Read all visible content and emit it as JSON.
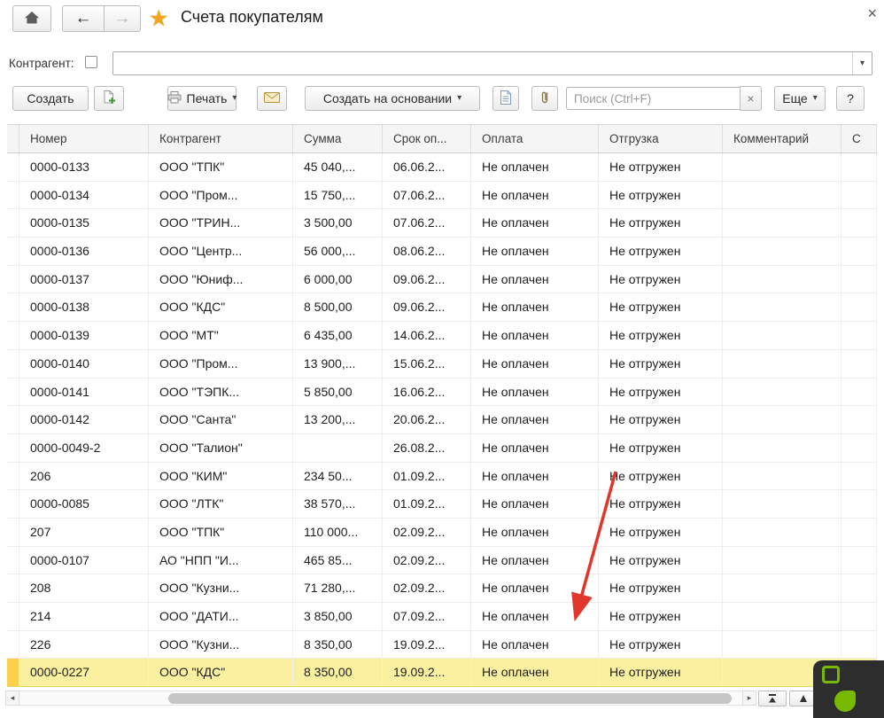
{
  "window": {
    "title": "Счета покупателям",
    "close_label": "×"
  },
  "nav": {
    "back_label": "←",
    "forward_label": "→",
    "favorite_star": "★"
  },
  "filter": {
    "label": "Контрагент:",
    "value": "",
    "caret": "▾"
  },
  "toolbar": {
    "create_label": "Создать",
    "print_label": "Печать",
    "create_based_on_label": "Создать на основании",
    "search_placeholder": "Поиск (Ctrl+F)",
    "clear_label": "×",
    "more_label": "Еще",
    "help_label": "?",
    "caret": "▾"
  },
  "table": {
    "columns": [
      "Номер",
      "Контрагент",
      "Сумма",
      "Срок оп...",
      "Оплата",
      "Отгрузка",
      "Комментарий",
      "С"
    ],
    "rows": [
      {
        "number": "0000-0133",
        "counterparty": "ООО \"ТПК\"",
        "sum": "45 040,...",
        "due": "06.06.2...",
        "payment": "Не оплачен",
        "shipment": "Не отгружен",
        "comment": "",
        "overdue": true,
        "highlighted": false
      },
      {
        "number": "0000-0134",
        "counterparty": "ООО \"Пром...",
        "sum": "15 750,...",
        "due": "07.06.2...",
        "payment": "Не оплачен",
        "shipment": "Не отгружен",
        "comment": "",
        "overdue": true,
        "highlighted": false
      },
      {
        "number": "0000-0135",
        "counterparty": "ООО \"ТРИН...",
        "sum": "3 500,00",
        "due": "07.06.2...",
        "payment": "Не оплачен",
        "shipment": "Не отгружен",
        "comment": "",
        "overdue": true,
        "highlighted": false
      },
      {
        "number": "0000-0136",
        "counterparty": "ООО \"Центр...",
        "sum": "56 000,...",
        "due": "08.06.2...",
        "payment": "Не оплачен",
        "shipment": "Не отгружен",
        "comment": "",
        "overdue": true,
        "highlighted": false
      },
      {
        "number": "0000-0137",
        "counterparty": "ООО \"Юниф...",
        "sum": "6 000,00",
        "due": "09.06.2...",
        "payment": "Не оплачен",
        "shipment": "Не отгружен",
        "comment": "",
        "overdue": true,
        "highlighted": false
      },
      {
        "number": "0000-0138",
        "counterparty": "ООО \"КДС\"",
        "sum": "8 500,00",
        "due": "09.06.2...",
        "payment": "Не оплачен",
        "shipment": "Не отгружен",
        "comment": "",
        "overdue": true,
        "highlighted": false
      },
      {
        "number": "0000-0139",
        "counterparty": "ООО \"МТ\"",
        "sum": "6 435,00",
        "due": "14.06.2...",
        "payment": "Не оплачен",
        "shipment": "Не отгружен",
        "comment": "",
        "overdue": true,
        "highlighted": false
      },
      {
        "number": "0000-0140",
        "counterparty": "ООО \"Пром...",
        "sum": "13 900,...",
        "due": "15.06.2...",
        "payment": "Не оплачен",
        "shipment": "Не отгружен",
        "comment": "",
        "overdue": true,
        "highlighted": false
      },
      {
        "number": "0000-0141",
        "counterparty": "ООО \"ТЭПК...",
        "sum": "5 850,00",
        "due": "16.06.2...",
        "payment": "Не оплачен",
        "shipment": "Не отгружен",
        "comment": "",
        "overdue": true,
        "highlighted": false
      },
      {
        "number": "0000-0142",
        "counterparty": "ООО \"Санта\"",
        "sum": "13 200,...",
        "due": "20.06.2...",
        "payment": "Не оплачен",
        "shipment": "Не отгружен",
        "comment": "",
        "overdue": true,
        "highlighted": false
      },
      {
        "number": "0000-0049-2",
        "counterparty": "ООО \"Талион\"",
        "sum": "",
        "due": "26.08.2...",
        "payment": "Не оплачен",
        "shipment": "Не отгружен",
        "comment": "",
        "overdue": true,
        "highlighted": false
      },
      {
        "number": "206",
        "counterparty": "ООО \"КИМ\"",
        "sum": "234 50...",
        "due": "01.09.2...",
        "payment": "Не оплачен",
        "shipment": "Не отгружен",
        "comment": "",
        "overdue": true,
        "highlighted": false
      },
      {
        "number": "0000-0085",
        "counterparty": "ООО \"ЛТК\"",
        "sum": "38 570,...",
        "due": "01.09.2...",
        "payment": "Не оплачен",
        "shipment": "Не отгружен",
        "comment": "",
        "overdue": true,
        "highlighted": false
      },
      {
        "number": "207",
        "counterparty": "ООО \"ТПК\"",
        "sum": "110 000...",
        "due": "02.09.2...",
        "payment": "Не оплачен",
        "shipment": "Не отгружен",
        "comment": "",
        "overdue": true,
        "highlighted": false
      },
      {
        "number": "0000-0107",
        "counterparty": "АО \"НПП \"И...",
        "sum": "465 85...",
        "due": "02.09.2...",
        "payment": "Не оплачен",
        "shipment": "Не отгружен",
        "comment": "",
        "overdue": true,
        "highlighted": false
      },
      {
        "number": "208",
        "counterparty": "ООО \"Кузни...",
        "sum": "71 280,...",
        "due": "02.09.2...",
        "payment": "Не оплачен",
        "shipment": "Не отгружен",
        "comment": "",
        "overdue": true,
        "highlighted": false
      },
      {
        "number": "214",
        "counterparty": "ООО \"ДАТИ...",
        "sum": "3 850,00",
        "due": "07.09.2...",
        "payment": "Не оплачен",
        "shipment": "Не отгружен",
        "comment": "",
        "overdue": true,
        "highlighted": false
      },
      {
        "number": "226",
        "counterparty": "ООО \"Кузни...",
        "sum": "8 350,00",
        "due": "19.09.2...",
        "payment": "Не оплачен",
        "shipment": "Не отгружен",
        "comment": "",
        "overdue": false,
        "highlighted": false
      },
      {
        "number": "0000-0227",
        "counterparty": "ООО \"КДС\"",
        "sum": "8 350,00",
        "due": "19.09.2...",
        "payment": "Не оплачен",
        "shipment": "Не отгружен",
        "comment": "",
        "overdue": false,
        "highlighted": true
      }
    ]
  },
  "scrollbar": {
    "left_arrow": "◂",
    "right_arrow": "▸"
  },
  "colors": {
    "overdue_red": "#e03a2e",
    "highlight_yellow": "#fbf0a0",
    "marker_yellow": "#fccf4d",
    "star_orange": "#f2a41f",
    "annotation_red": "#e0362b",
    "nvidia_green": "#76b900"
  }
}
